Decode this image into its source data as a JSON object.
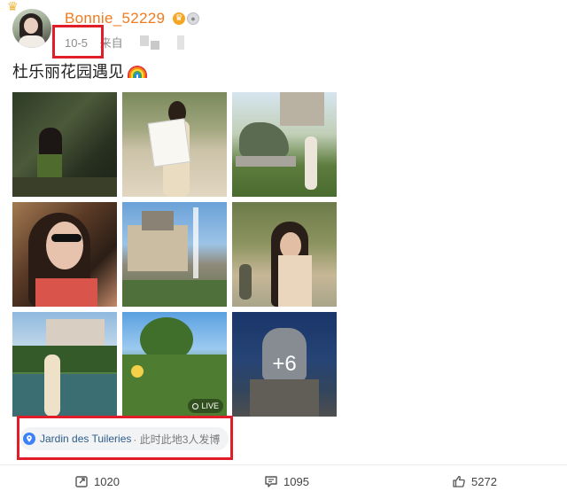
{
  "post": {
    "username": "Bonnie_52229",
    "date": "10-5",
    "source_prefix": "来自",
    "text": "杜乐丽花园遇见",
    "emoji": "rainbow-emoji",
    "more_photos_label": "+6",
    "live_label": "LIVE",
    "images": [
      {
        "name": "photo-garden-woman-sitting"
      },
      {
        "name": "photo-woman-with-shopping-bag"
      },
      {
        "name": "photo-horse-statue-palace"
      },
      {
        "name": "photo-woman-sunglasses-portrait"
      },
      {
        "name": "photo-louvre-fountain"
      },
      {
        "name": "photo-woman-sunglasses-garden"
      },
      {
        "name": "photo-woman-by-pond"
      },
      {
        "name": "photo-garden-trees"
      },
      {
        "name": "photo-statue-night"
      }
    ]
  },
  "location": {
    "name": "Jardin des Tuileries",
    "extra": "· 此时此地3人发博"
  },
  "actions": {
    "repost_count": "1020",
    "comment_count": "1095",
    "like_count": "5272"
  },
  "colors": {
    "username": "#f07b1e",
    "highlight_box": "#e11d2a",
    "location_text": "#2e5c8a"
  }
}
